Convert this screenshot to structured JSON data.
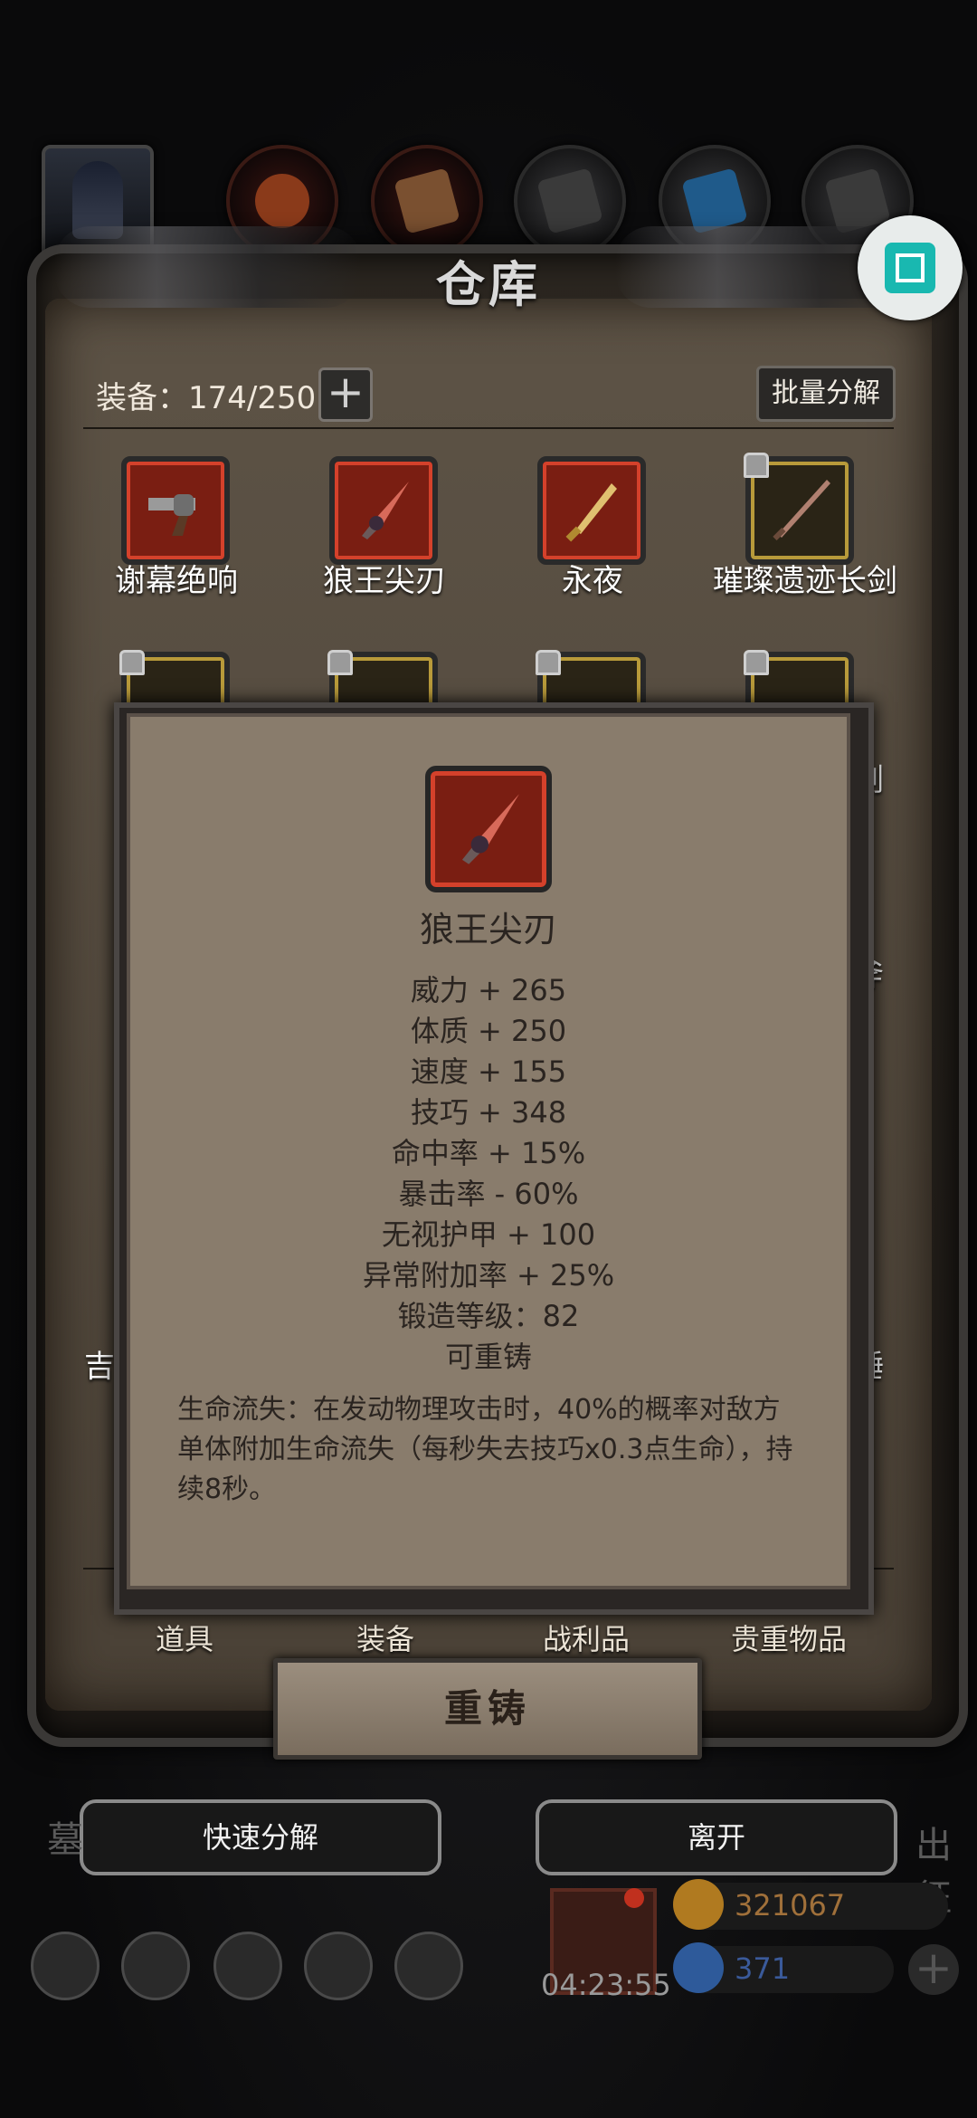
{
  "window": {
    "title": "仓库"
  },
  "inventory": {
    "count_label": "装备：174/250",
    "batch_label": "批量分解",
    "row1": [
      {
        "name": "谢幕绝响"
      },
      {
        "name": "狼王尖刃"
      },
      {
        "name": "永夜"
      },
      {
        "name": "璀璨遗迹长剑"
      }
    ],
    "partial_labels": [
      "剑",
      "斧",
      "锤",
      "吉"
    ]
  },
  "tabs": [
    "道具",
    "装备",
    "战利品",
    "贵重物品"
  ],
  "popup": {
    "item_name": "狼王尖刃",
    "stats": [
      "威力 + 265",
      "体质 + 250",
      "速度 + 155",
      "技巧 + 348",
      "命中率 + 15%",
      "暴击率 - 60%",
      "无视护甲 + 100",
      "异常附加率 + 25%",
      "锻造等级：82",
      "可重铸"
    ],
    "description": "生命流失：在发动物理攻击时，40%的概率对敌方单体附加生命流失（每秒失去技巧x0.3点生命），持续8秒。",
    "reforge_label": "重铸"
  },
  "bottom": {
    "quick_decompose": "快速分解",
    "leave": "离开",
    "left_side": "墓",
    "right_side": "出征",
    "timer": "04:23:55",
    "gold": "321067",
    "gems": "371"
  },
  "colors": {
    "gold_text": "#a0703a",
    "gem_text": "#3a5a9a"
  }
}
